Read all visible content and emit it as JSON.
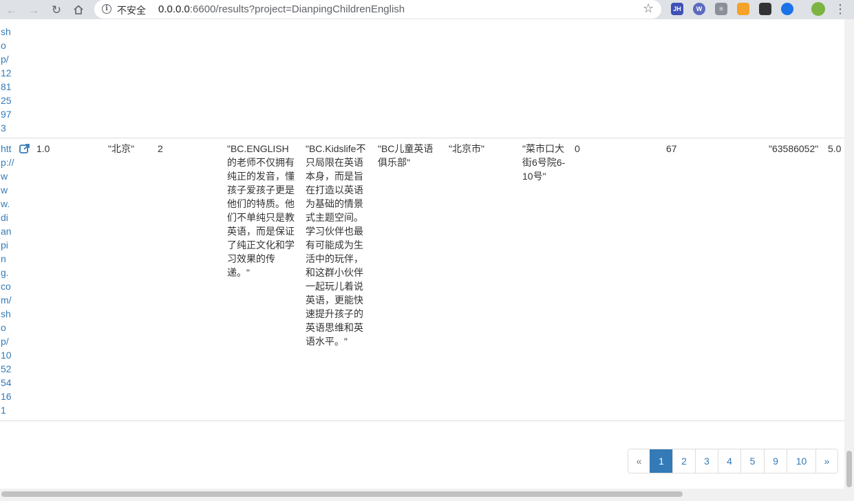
{
  "browser": {
    "info_symbol": "i",
    "security_label": "不安全",
    "url_host": "0.0.0.0",
    "url_path": ":6600/results?project=DianpingChildrenEnglish",
    "extensions": [
      {
        "name": "jsonhandle-extension",
        "label": "JH",
        "color": "#3f51b5"
      },
      {
        "name": "web-extension",
        "label": "W",
        "color": "#5c6bc0"
      },
      {
        "name": "react-devtools-extension",
        "label": "⚛",
        "color": "#8a8f98"
      },
      {
        "name": "rss-extension",
        "label": "",
        "color": "#f4a229"
      },
      {
        "name": "qr-code-extension",
        "label": "",
        "color": "#333333"
      },
      {
        "name": "blue-extension",
        "label": "",
        "color": "#1a73e8"
      }
    ]
  },
  "results": {
    "rows": [
      {
        "url_fragment": "sh\no\np/\n12\n81\n25\n97\n3"
      },
      {
        "url": "htt\np://\nw\nw\nw.\ndi\nan\npi\nn\ng.\nco\nm/\nsh\no\np/\n10\n52\n54\n16\n1",
        "score": "1.0",
        "city": "\"北京\"",
        "count": "2",
        "comment_1": "\"BC.ENGLISH的老师不仅拥有纯正的发音，懂孩子爱孩子更是他们的特质。他们不单纯只是教英语，而是保证了纯正文化和学习效果的传递。\"",
        "comment_2": "\"BC.Kidslife不只局限在英语本身，而是旨在打造以英语为基础的情景式主题空间。学习伙伴也最有可能成为生活中的玩伴，和这群小伙伴一起玩儿着说英语，更能快速提升孩子的英语思维和英语水平。\"",
        "shop_name": "\"BC儿童英语俱乐部\"",
        "region": "\"北京市\"",
        "address": "\"菜市口大街6号院6-10号\"",
        "zero_field": "0",
        "num_field": "67",
        "phone": "\"63586052\"",
        "rating": "5.0"
      }
    ]
  },
  "pagination": {
    "prev": "«",
    "pages": [
      "1",
      "2",
      "3",
      "4",
      "5",
      "9",
      "10"
    ],
    "next": "»",
    "active_page": "1"
  }
}
